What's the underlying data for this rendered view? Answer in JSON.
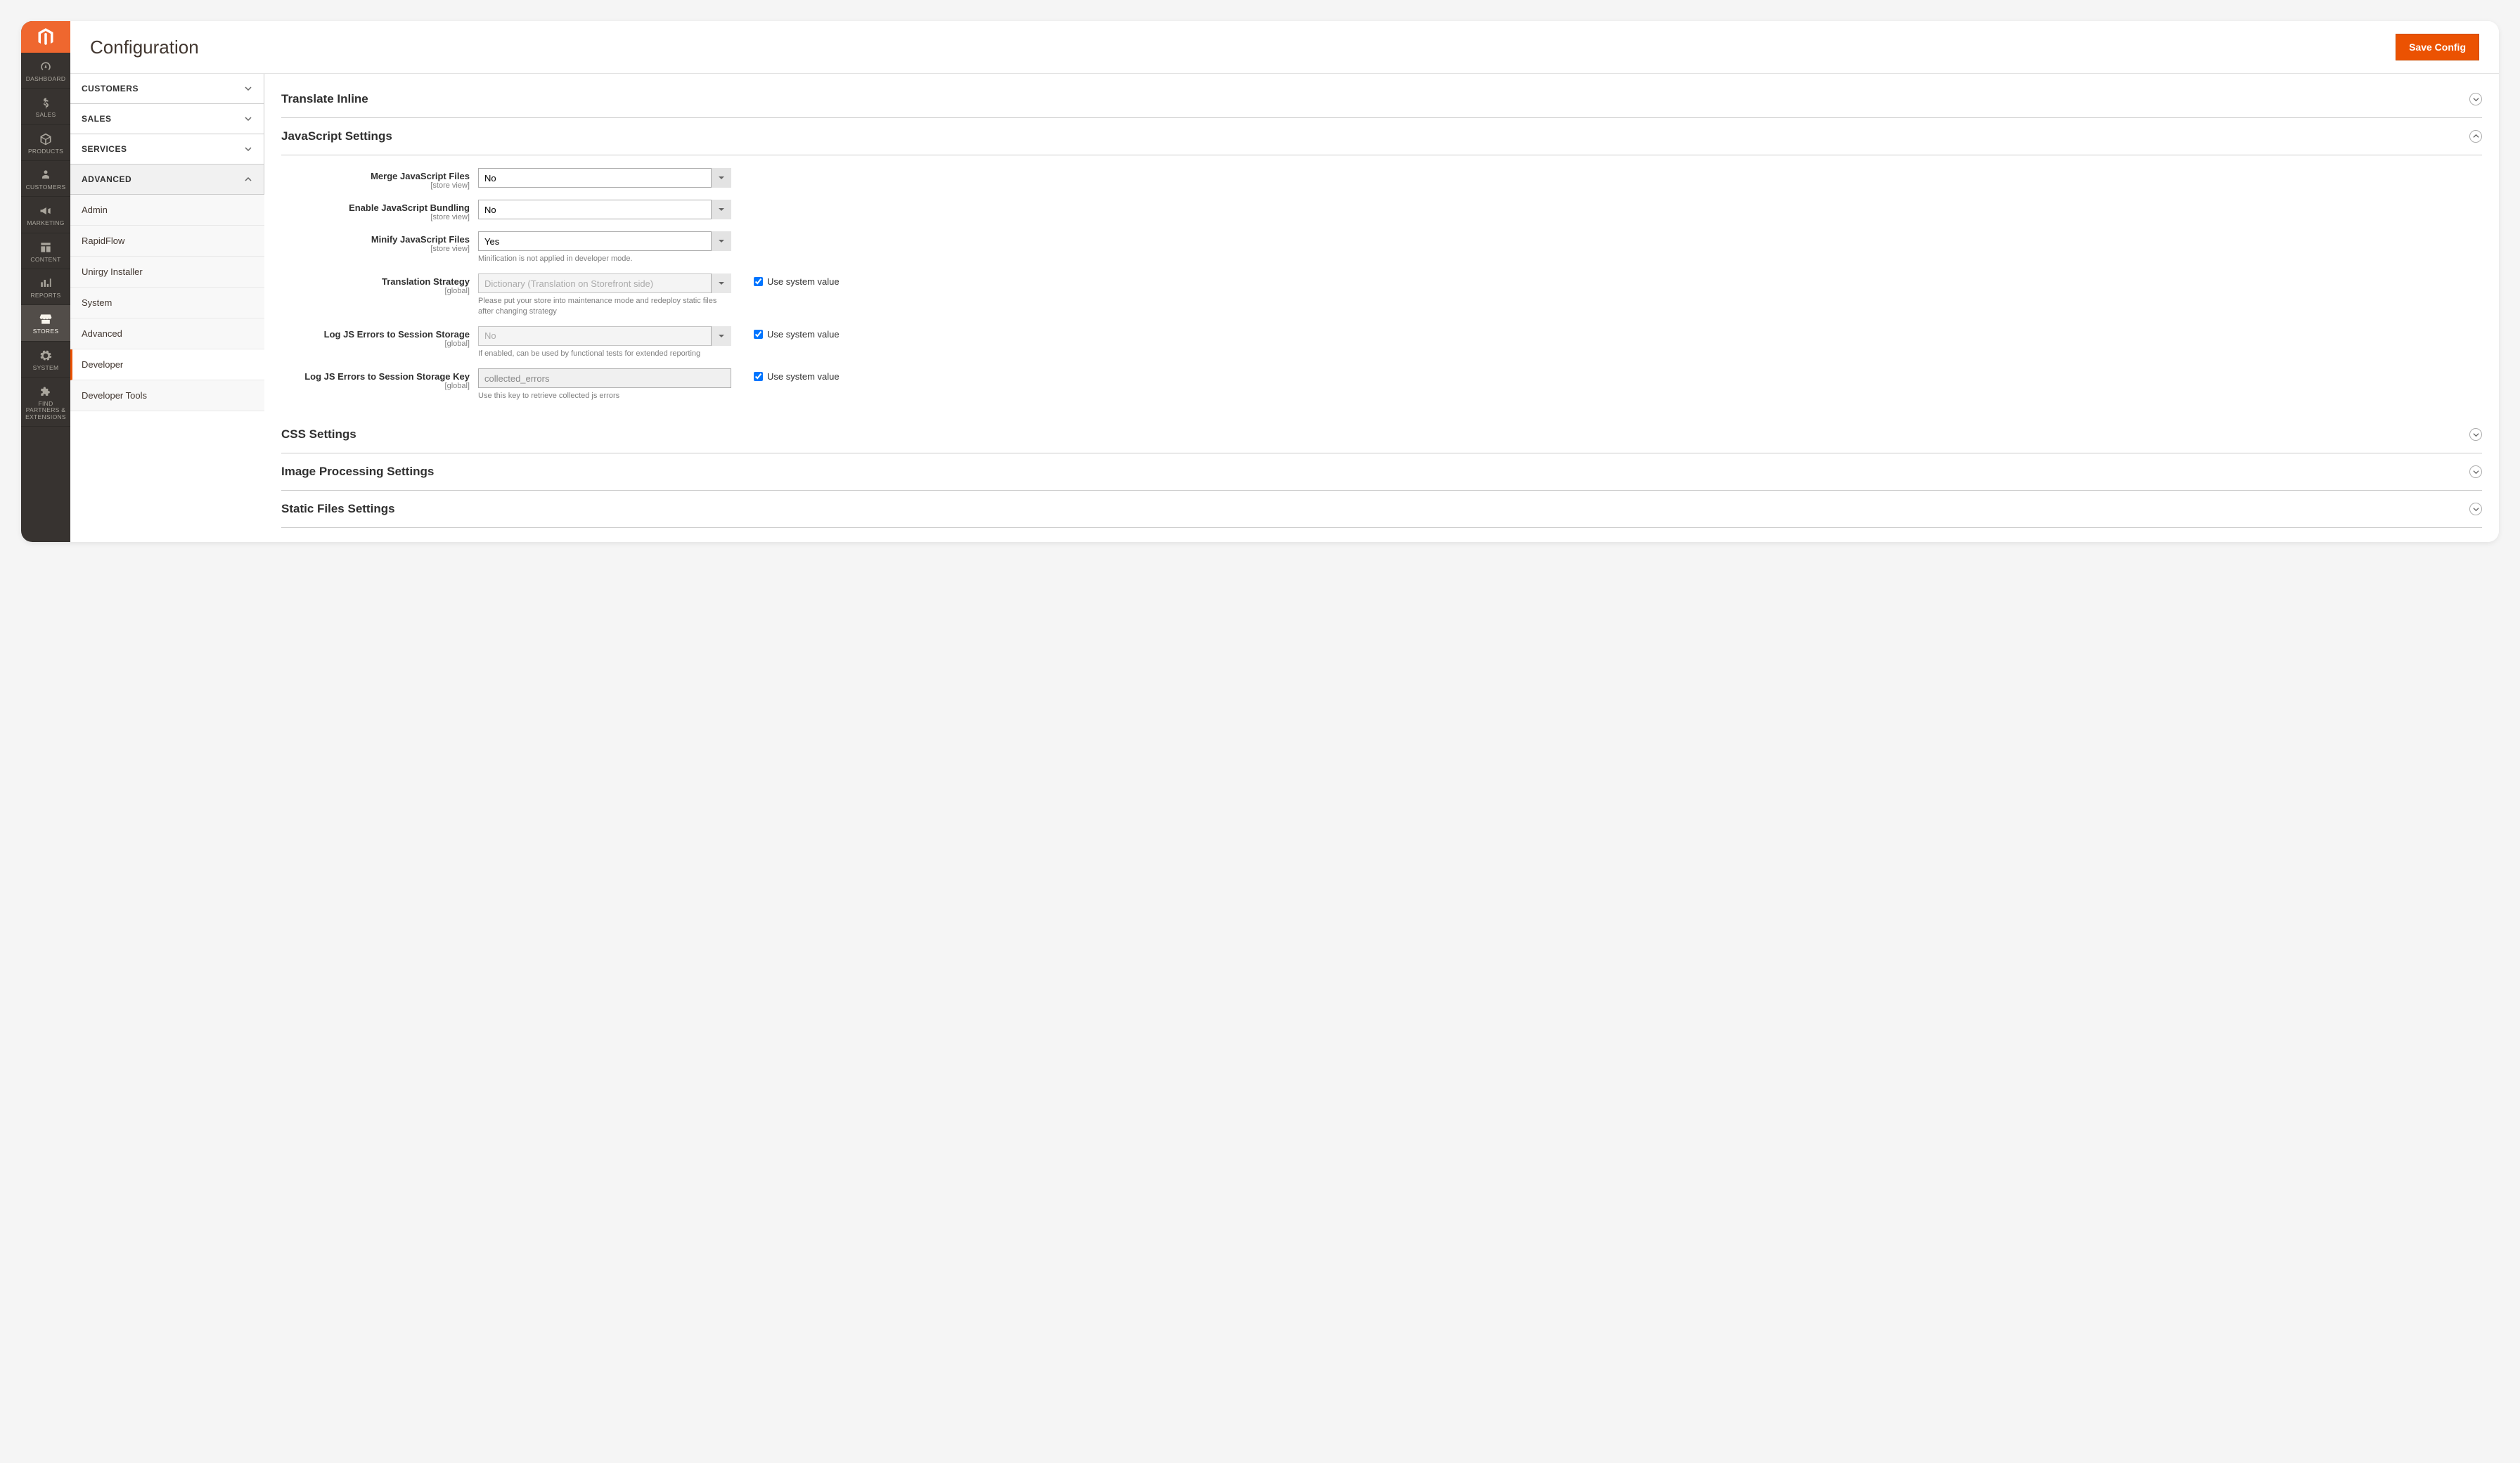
{
  "pageTitle": "Configuration",
  "saveLabel": "Save Config",
  "nav": [
    {
      "label": "DASHBOARD",
      "icon": "gauge"
    },
    {
      "label": "SALES",
      "icon": "dollar"
    },
    {
      "label": "PRODUCTS",
      "icon": "box"
    },
    {
      "label": "CUSTOMERS",
      "icon": "person"
    },
    {
      "label": "MARKETING",
      "icon": "megaphone"
    },
    {
      "label": "CONTENT",
      "icon": "layout"
    },
    {
      "label": "REPORTS",
      "icon": "bars"
    },
    {
      "label": "STORES",
      "icon": "store",
      "active": true
    },
    {
      "label": "SYSTEM",
      "icon": "gear"
    },
    {
      "label": "FIND PARTNERS & EXTENSIONS",
      "icon": "puzzle"
    }
  ],
  "tabGroups": [
    {
      "title": "CUSTOMERS",
      "expanded": false
    },
    {
      "title": "SALES",
      "expanded": false
    },
    {
      "title": "SERVICES",
      "expanded": false
    },
    {
      "title": "ADVANCED",
      "expanded": true,
      "items": [
        {
          "label": "Admin"
        },
        {
          "label": "RapidFlow"
        },
        {
          "label": "Unirgy Installer"
        },
        {
          "label": "System"
        },
        {
          "label": "Advanced"
        },
        {
          "label": "Developer",
          "active": true
        },
        {
          "label": "Developer Tools"
        }
      ]
    }
  ],
  "sections": [
    {
      "title": "Translate Inline",
      "expanded": false
    },
    {
      "title": "JavaScript Settings",
      "expanded": true
    },
    {
      "title": "CSS Settings",
      "expanded": false
    },
    {
      "title": "Image Processing Settings",
      "expanded": false
    },
    {
      "title": "Static Files Settings",
      "expanded": false
    }
  ],
  "fields": {
    "merge_js": {
      "label": "Merge JavaScript Files",
      "scope": "[store view]",
      "value": "No"
    },
    "bundle_js": {
      "label": "Enable JavaScript Bundling",
      "scope": "[store view]",
      "value": "No"
    },
    "minify_js": {
      "label": "Minify JavaScript Files",
      "scope": "[store view]",
      "value": "Yes",
      "note": "Minification is not applied in developer mode."
    },
    "trans_strat": {
      "label": "Translation Strategy",
      "scope": "[global]",
      "value": "Dictionary (Translation on Storefront side)",
      "note": "Please put your store into maintenance mode and redeploy static files after changing strategy",
      "disabled": true,
      "useSystem": true
    },
    "log_errors": {
      "label": "Log JS Errors to Session Storage",
      "scope": "[global]",
      "value": "No",
      "note": "If enabled, can be used by functional tests for extended reporting",
      "disabled": true,
      "useSystem": true
    },
    "log_key": {
      "label": "Log JS Errors to Session Storage Key",
      "scope": "[global]",
      "value": "collected_errors",
      "note": "Use this key to retrieve collected js errors",
      "disabled": true,
      "useSystem": true,
      "isText": true
    }
  },
  "useSystemLabel": "Use system value"
}
